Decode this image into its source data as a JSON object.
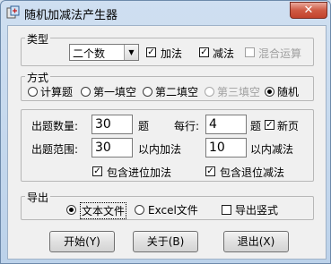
{
  "window": {
    "title": "随机加减法产生器",
    "close_glyph": "✕"
  },
  "type_group": {
    "label": "类型",
    "count_select": "二个数",
    "add": {
      "label": "加法",
      "checked": true
    },
    "sub": {
      "label": "减法",
      "checked": true
    },
    "mixed": {
      "label": "混合运算",
      "checked": false,
      "enabled": false
    }
  },
  "mode_group": {
    "label": "方式",
    "options": [
      "计算题",
      "第一填空",
      "第二填空",
      "第三填空",
      "随机"
    ],
    "selected": "随机",
    "disabled": [
      "第三填空"
    ]
  },
  "settings": {
    "count_label": "出题数量:",
    "count_value": "30",
    "count_unit": "题",
    "per_row_label": "每行:",
    "per_row_value": "4",
    "per_row_unit": "题",
    "new_page": {
      "label": "新页",
      "checked": true
    },
    "range_label": "出题范围:",
    "add_range_value": "30",
    "add_range_unit": "以内加法",
    "sub_range_value": "10",
    "sub_range_unit": "以内减法",
    "carry": {
      "label": "包含进位加法",
      "checked": true
    },
    "borrow": {
      "label": "包含退位减法",
      "checked": true
    }
  },
  "export_group": {
    "label": "导出",
    "text_file": {
      "label": "文本文件",
      "selected": true
    },
    "excel_file": {
      "label": "Excel文件",
      "selected": false
    },
    "vertical": {
      "label": "导出竖式",
      "checked": false
    }
  },
  "buttons": {
    "start": "开始(Y)",
    "about": "关于(B)",
    "exit": "退出(X)"
  },
  "icons": {
    "check": "✓",
    "combo_arrow": "▼"
  }
}
